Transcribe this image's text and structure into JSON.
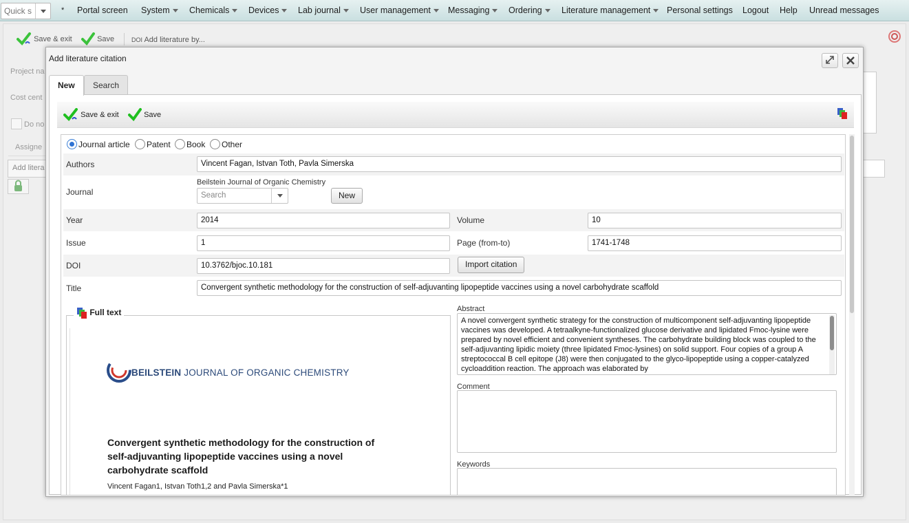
{
  "menubar": {
    "quick_search_placeholder": "Quick s",
    "star": "*",
    "items": [
      {
        "label": "Portal screen"
      },
      {
        "label": "System"
      },
      {
        "label": "Chemicals"
      },
      {
        "label": "Devices"
      },
      {
        "label": "Lab journal"
      },
      {
        "label": "User management"
      },
      {
        "label": "Messaging"
      },
      {
        "label": "Ordering"
      },
      {
        "label": "Literature management"
      },
      {
        "label": "Personal settings"
      },
      {
        "label": "Logout"
      },
      {
        "label": "Help"
      },
      {
        "label": "Unread messages"
      }
    ]
  },
  "background": {
    "save_exit_label": "Save & exit",
    "save_label": "Save",
    "doi_prefix": "DOI",
    "add_literature_by": "Add literature by...",
    "project_name_label": "Project na",
    "cost_center_label": "Cost cent",
    "do_not_label": "Do no",
    "assigned_label": "Assigne",
    "add_literature_label": "Add litera"
  },
  "modal": {
    "title": "Add literature citation",
    "tabs": [
      {
        "label": "New"
      },
      {
        "label": "Search"
      }
    ],
    "toolbar": {
      "save_exit_label": "Save & exit",
      "save_label": "Save"
    },
    "types": [
      {
        "label": "Journal article",
        "selected": true
      },
      {
        "label": "Patent",
        "selected": false
      },
      {
        "label": "Book",
        "selected": false
      },
      {
        "label": "Other",
        "selected": false
      }
    ],
    "form": {
      "authors_label": "Authors",
      "authors_value": "Vincent Fagan, Istvan Toth, Pavla Simerska",
      "journal_label": "Journal",
      "journal_value": "Beilstein Journal of Organic Chemistry",
      "journal_search_placeholder": "Search",
      "journal_new_button": "New",
      "year_label": "Year",
      "year_value": "2014",
      "volume_label": "Volume",
      "volume_value": "10",
      "issue_label": "Issue",
      "issue_value": "1",
      "page_label": "Page (from-to)",
      "page_value": "1741-1748",
      "doi_label": "DOI",
      "doi_value": "10.3762/bjoc.10.181",
      "import_button": "Import citation",
      "title_label": "Title",
      "title_value": "Convergent synthetic methodology for the construction of self-adjuvanting lipopeptide vaccines using a novel carbohydrate scaffold",
      "fulltext_label": "Full text",
      "abstract_label": "Abstract",
      "abstract_value": "A novel convergent synthetic strategy for the construction of multicomponent self-adjuvanting lipopeptide vaccines was developed. A tetraalkyne-functionalized glucose derivative and lipidated Fmoc-lysine were prepared by novel efficient and convenient syntheses. The carbohydrate building block was coupled to the self-adjuvanting lipidic moiety (three lipidated Fmoc-lysines) on solid support. Four copies of a group A streptococcal B cell epitope (J8) were then conjugated to the glyco-lipopeptide using a copper-catalyzed cycloaddition reaction. The approach was elaborated by",
      "comment_label": "Comment",
      "comment_value": "",
      "keywords_label": "Keywords",
      "keywords_value": ""
    },
    "pdf_preview": {
      "journal_bold": "BEILSTEIN",
      "journal_rest": " JOURNAL OF ORGANIC CHEMISTRY",
      "title": "Convergent synthetic methodology for the construction of self-adjuvanting lipopeptide vaccines using a novel carbohydrate scaffold",
      "authors": "Vincent Fagan1, Istvan Toth1,2 and Pavla Simerska*1"
    }
  }
}
